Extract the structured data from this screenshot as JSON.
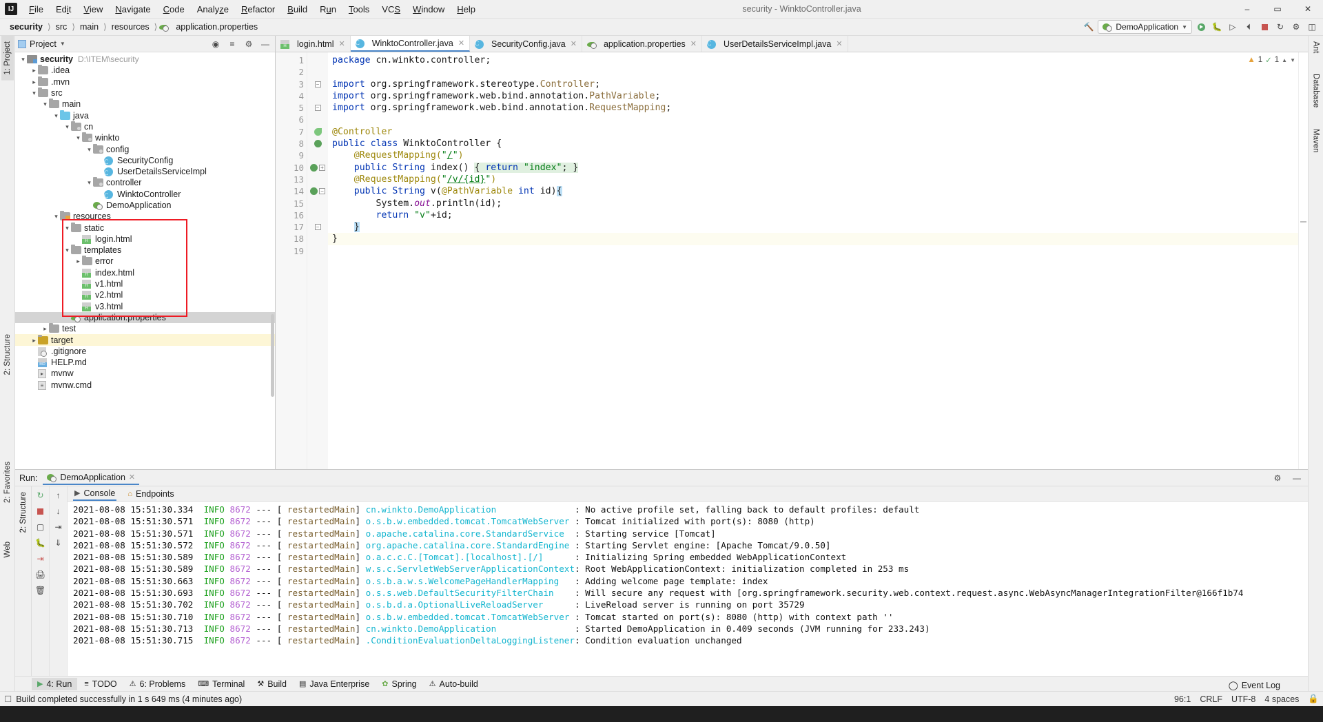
{
  "window": {
    "title": "security - WinktoController.java",
    "logo": "IJ",
    "minimize": "–",
    "maximize": "▭",
    "close": "✕"
  },
  "menu": {
    "items": [
      "File",
      "Edit",
      "View",
      "Navigate",
      "Code",
      "Analyze",
      "Refactor",
      "Build",
      "Run",
      "Tools",
      "VCS",
      "Window",
      "Help"
    ]
  },
  "navbar": {
    "breadcrumb": [
      "security",
      "src",
      "main",
      "resources",
      "application.properties"
    ],
    "run_config": "DemoApplication",
    "icons": [
      "hammer-icon",
      "search-icon",
      "run-icon",
      "debug-icon",
      "coverage-icon",
      "profile-icon",
      "stop-icon",
      "update-icon",
      "settings-icon",
      "layout-icon"
    ]
  },
  "left_strip": {
    "tabs": [
      "1: Project",
      "2: Structure",
      "2: Favorites",
      "Web"
    ]
  },
  "right_strip": {
    "tabs": [
      "Ant",
      "Database",
      "Maven"
    ]
  },
  "project_panel": {
    "title": "Project",
    "header_icons": [
      "target-icon",
      "collapse-icon",
      "gear-icon",
      "hide-icon"
    ],
    "tree": [
      {
        "depth": 0,
        "arrow": "open",
        "icon": "module-folder",
        "label": "security",
        "bold": true,
        "path": "D:\\ITEM\\security"
      },
      {
        "depth": 1,
        "arrow": "closed",
        "icon": "folder",
        "label": ".idea"
      },
      {
        "depth": 1,
        "arrow": "closed",
        "icon": "folder",
        "label": ".mvn"
      },
      {
        "depth": 1,
        "arrow": "open",
        "icon": "folder",
        "label": "src"
      },
      {
        "depth": 2,
        "arrow": "open",
        "icon": "folder",
        "label": "main"
      },
      {
        "depth": 3,
        "arrow": "open",
        "icon": "folder-blue",
        "label": "java"
      },
      {
        "depth": 4,
        "arrow": "open",
        "icon": "package-folder",
        "label": "cn"
      },
      {
        "depth": 5,
        "arrow": "open",
        "icon": "package-folder",
        "label": "winkto"
      },
      {
        "depth": 6,
        "arrow": "open",
        "icon": "package-folder",
        "label": "config"
      },
      {
        "depth": 7,
        "arrow": "none",
        "icon": "java-class",
        "label": "SecurityConfig"
      },
      {
        "depth": 7,
        "arrow": "none",
        "icon": "java-class",
        "label": "UserDetailsServiceImpl"
      },
      {
        "depth": 6,
        "arrow": "open",
        "icon": "package-folder",
        "label": "controller"
      },
      {
        "depth": 7,
        "arrow": "none",
        "icon": "java-class",
        "label": "WinktoController"
      },
      {
        "depth": 6,
        "arrow": "none",
        "icon": "spring-run",
        "label": "DemoApplication"
      },
      {
        "depth": 3,
        "arrow": "open",
        "icon": "resources-folder",
        "label": "resources"
      },
      {
        "depth": 4,
        "arrow": "open",
        "icon": "folder",
        "label": "static"
      },
      {
        "depth": 5,
        "arrow": "none",
        "icon": "html-file",
        "label": "login.html"
      },
      {
        "depth": 4,
        "arrow": "open",
        "icon": "folder",
        "label": "templates"
      },
      {
        "depth": 5,
        "arrow": "closed",
        "icon": "folder",
        "label": "error"
      },
      {
        "depth": 5,
        "arrow": "none",
        "icon": "html-file",
        "label": "index.html"
      },
      {
        "depth": 5,
        "arrow": "none",
        "icon": "html-file",
        "label": "v1.html"
      },
      {
        "depth": 5,
        "arrow": "none",
        "icon": "html-file",
        "label": "v2.html"
      },
      {
        "depth": 5,
        "arrow": "none",
        "icon": "html-file",
        "label": "v3.html"
      },
      {
        "depth": 4,
        "arrow": "none",
        "icon": "spring-properties",
        "label": "application.properties",
        "selected": true
      },
      {
        "depth": 2,
        "arrow": "closed",
        "icon": "folder",
        "label": "test"
      },
      {
        "depth": 1,
        "arrow": "closed",
        "icon": "folder-orange",
        "label": "target",
        "yellow": true
      },
      {
        "depth": 1,
        "arrow": "none",
        "icon": "gitignore-file",
        "label": ".gitignore"
      },
      {
        "depth": 1,
        "arrow": "none",
        "icon": "md-file",
        "label": "HELP.md"
      },
      {
        "depth": 1,
        "arrow": "none",
        "icon": "shell-file",
        "label": "mvnw"
      },
      {
        "depth": 1,
        "arrow": "none",
        "icon": "cmd-file",
        "label": "mvnw.cmd"
      }
    ],
    "highlight_box": "resources-static-templates-region"
  },
  "editor": {
    "tabs": [
      {
        "label": "login.html",
        "icon": "html-file",
        "active": false
      },
      {
        "label": "WinktoController.java",
        "icon": "java-class",
        "active": true
      },
      {
        "label": "SecurityConfig.java",
        "icon": "java-class",
        "active": false
      },
      {
        "label": "application.properties",
        "icon": "spring-properties",
        "active": false
      },
      {
        "label": "UserDetailsServiceImpl.java",
        "icon": "java-class",
        "active": false
      }
    ],
    "inspections": {
      "warnings": "1",
      "oks": "1"
    },
    "line_numbers": [
      "1",
      "2",
      "3",
      "4",
      "5",
      "6",
      "7",
      "8",
      "9",
      "10",
      "13",
      "14",
      "15",
      "16",
      "17",
      "18",
      "19"
    ],
    "current_line_index": 15,
    "lines": [
      [
        {
          "t": "package ",
          "c": "kw"
        },
        {
          "t": "cn.winkto.controller;",
          "c": ""
        }
      ],
      [],
      [
        {
          "t": "import ",
          "c": "kw"
        },
        {
          "t": "org.springframework.stereotype.",
          "c": ""
        },
        {
          "t": "Controller",
          "c": "cls"
        },
        {
          "t": ";",
          "c": ""
        }
      ],
      [
        {
          "t": "import ",
          "c": "kw"
        },
        {
          "t": "org.springframework.web.bind.annotation.",
          "c": ""
        },
        {
          "t": "PathVariable",
          "c": "cls"
        },
        {
          "t": ";",
          "c": ""
        }
      ],
      [
        {
          "t": "import ",
          "c": "kw"
        },
        {
          "t": "org.springframework.web.bind.annotation.",
          "c": ""
        },
        {
          "t": "RequestMapping",
          "c": "cls"
        },
        {
          "t": ";",
          "c": ""
        }
      ],
      [],
      [
        {
          "t": "@Controller",
          "c": "anno"
        }
      ],
      [
        {
          "t": "public class ",
          "c": "kw"
        },
        {
          "t": "WinktoController {",
          "c": ""
        }
      ],
      [
        {
          "t": "    @RequestMapping(",
          "c": "anno"
        },
        {
          "t": "\"",
          "c": "str"
        },
        {
          "t": "/",
          "c": "str uline"
        },
        {
          "t": "\"",
          "c": "str"
        },
        {
          "t": ")",
          "c": "anno"
        }
      ],
      [
        {
          "t": "    ",
          "c": ""
        },
        {
          "t": "public String ",
          "c": "kw"
        },
        {
          "t": "index() ",
          "c": ""
        },
        {
          "t": "{ ",
          "c": "hl"
        },
        {
          "t": "return ",
          "c": "kw hl"
        },
        {
          "t": "\"index\"",
          "c": "str hl"
        },
        {
          "t": "; ",
          "c": "hl"
        },
        {
          "t": "}",
          "c": "hl"
        }
      ],
      [
        {
          "t": "    @RequestMapping(",
          "c": "anno"
        },
        {
          "t": "\"",
          "c": "str"
        },
        {
          "t": "/v/{id}",
          "c": "str uline"
        },
        {
          "t": "\"",
          "c": "str"
        },
        {
          "t": ")",
          "c": "anno"
        }
      ],
      [
        {
          "t": "    ",
          "c": ""
        },
        {
          "t": "public String ",
          "c": "kw"
        },
        {
          "t": "v(",
          "c": ""
        },
        {
          "t": "@PathVariable ",
          "c": "anno"
        },
        {
          "t": "int ",
          "c": "kw"
        },
        {
          "t": "id)",
          "c": ""
        },
        {
          "t": "{",
          "c": "hlb"
        }
      ],
      [
        {
          "t": "        System.",
          "c": ""
        },
        {
          "t": "out",
          "c": "fld"
        },
        {
          "t": ".println(id);",
          "c": ""
        }
      ],
      [
        {
          "t": "        ",
          "c": ""
        },
        {
          "t": "return ",
          "c": "kw"
        },
        {
          "t": "\"v\"",
          "c": "str"
        },
        {
          "t": "+id;",
          "c": ""
        }
      ],
      [
        {
          "t": "    ",
          "c": ""
        },
        {
          "t": "}",
          "c": "hlb"
        }
      ],
      [
        {
          "t": "}",
          "c": ""
        }
      ],
      []
    ],
    "gutter_marks": [
      {
        "line": 7,
        "icon": "bean-leaf-icon"
      },
      {
        "line": 8,
        "icon": "spring-bean-icon"
      },
      {
        "line": 10,
        "icon": "spring-mapping-icon",
        "fold": "plus"
      },
      {
        "line": 14,
        "icon": "spring-mapping-icon",
        "fold": "minus"
      },
      {
        "line": 3,
        "fold": "minus"
      },
      {
        "line": 5,
        "fold": "minus"
      },
      {
        "line": 17,
        "fold": "minus"
      }
    ]
  },
  "run_panel": {
    "label": "Run:",
    "config_name": "DemoApplication",
    "tabs": [
      {
        "label": "Console",
        "icon": "console-icon",
        "active": true
      },
      {
        "label": "Endpoints",
        "icon": "endpoints-icon",
        "active": false
      }
    ],
    "side_icons": [
      "rerun-icon",
      "stop-icon",
      "camera-icon",
      "debug-icon",
      "export-icon",
      "print-icon",
      "trash-icon"
    ],
    "nav_icons": [
      "scroll-up-icon",
      "scroll-down-icon",
      "soft-wrap-icon",
      "scroll-end-icon"
    ],
    "head_right_icons": [
      "gear-icon",
      "hide-icon"
    ],
    "logs": [
      {
        "date": "2021-08-08 15:51:30.334",
        "level": "INFO",
        "pid": "8672",
        "thread": "restartedMain",
        "logger": "cn.winkto.DemoApplication",
        "msg": "No active profile set, falling back to default profiles: default"
      },
      {
        "date": "2021-08-08 15:51:30.571",
        "level": "INFO",
        "pid": "8672",
        "thread": "restartedMain",
        "logger": "o.s.b.w.embedded.tomcat.TomcatWebServer",
        "msg": "Tomcat initialized with port(s): 8080 (http)"
      },
      {
        "date": "2021-08-08 15:51:30.571",
        "level": "INFO",
        "pid": "8672",
        "thread": "restartedMain",
        "logger": "o.apache.catalina.core.StandardService",
        "msg": "Starting service [Tomcat]"
      },
      {
        "date": "2021-08-08 15:51:30.572",
        "level": "INFO",
        "pid": "8672",
        "thread": "restartedMain",
        "logger": "org.apache.catalina.core.StandardEngine",
        "msg": "Starting Servlet engine: [Apache Tomcat/9.0.50]"
      },
      {
        "date": "2021-08-08 15:51:30.589",
        "level": "INFO",
        "pid": "8672",
        "thread": "restartedMain",
        "logger": "o.a.c.c.C.[Tomcat].[localhost].[/]",
        "msg": "Initializing Spring embedded WebApplicationContext"
      },
      {
        "date": "2021-08-08 15:51:30.589",
        "level": "INFO",
        "pid": "8672",
        "thread": "restartedMain",
        "logger": "w.s.c.ServletWebServerApplicationContext",
        "msg": "Root WebApplicationContext: initialization completed in 253 ms"
      },
      {
        "date": "2021-08-08 15:51:30.663",
        "level": "INFO",
        "pid": "8672",
        "thread": "restartedMain",
        "logger": "o.s.b.a.w.s.WelcomePageHandlerMapping",
        "msg": "Adding welcome page template: index"
      },
      {
        "date": "2021-08-08 15:51:30.693",
        "level": "INFO",
        "pid": "8672",
        "thread": "restartedMain",
        "logger": "o.s.s.web.DefaultSecurityFilterChain",
        "msg": "Will secure any request with [org.springframework.security.web.context.request.async.WebAsyncManagerIntegrationFilter@166f1b74"
      },
      {
        "date": "2021-08-08 15:51:30.702",
        "level": "INFO",
        "pid": "8672",
        "thread": "restartedMain",
        "logger": "o.s.b.d.a.OptionalLiveReloadServer",
        "msg": "LiveReload server is running on port 35729"
      },
      {
        "date": "2021-08-08 15:51:30.710",
        "level": "INFO",
        "pid": "8672",
        "thread": "restartedMain",
        "logger": "o.s.b.w.embedded.tomcat.TomcatWebServer",
        "msg": "Tomcat started on port(s): 8080 (http) with context path ''"
      },
      {
        "date": "2021-08-08 15:51:30.713",
        "level": "INFO",
        "pid": "8672",
        "thread": "restartedMain",
        "logger": "cn.winkto.DemoApplication",
        "msg": "Started DemoApplication in 0.409 seconds (JVM running for 233.243)"
      },
      {
        "date": "2021-08-08 15:51:30.715",
        "level": "INFO",
        "pid": "8672",
        "thread": "restartedMain",
        "logger": ".ConditionEvaluationDeltaLoggingListener",
        "msg": "Condition evaluation unchanged"
      }
    ]
  },
  "bottom_tabs": [
    {
      "label": "4: Run",
      "icon": "run-icon",
      "active": true
    },
    {
      "label": "TODO",
      "icon": "todo-icon",
      "active": false
    },
    {
      "label": "6: Problems",
      "icon": "problems-icon",
      "active": false
    },
    {
      "label": "Terminal",
      "icon": "terminal-icon",
      "active": false
    },
    {
      "label": "Build",
      "icon": "build-icon",
      "active": false
    },
    {
      "label": "Java Enterprise",
      "icon": "java-enterprise-icon",
      "active": false
    },
    {
      "label": "Spring",
      "icon": "spring-icon",
      "active": false
    },
    {
      "label": "Auto-build",
      "icon": "autobuild-icon",
      "active": false
    }
  ],
  "status_bar": {
    "message": "Build completed successfully in 1 s 649 ms (4 minutes ago)",
    "event_log": "Event Log",
    "caret": "96:1",
    "line_sep": "CRLF",
    "encoding": "UTF-8",
    "indent": "4 spaces",
    "lock_icon": "lock-icon"
  }
}
